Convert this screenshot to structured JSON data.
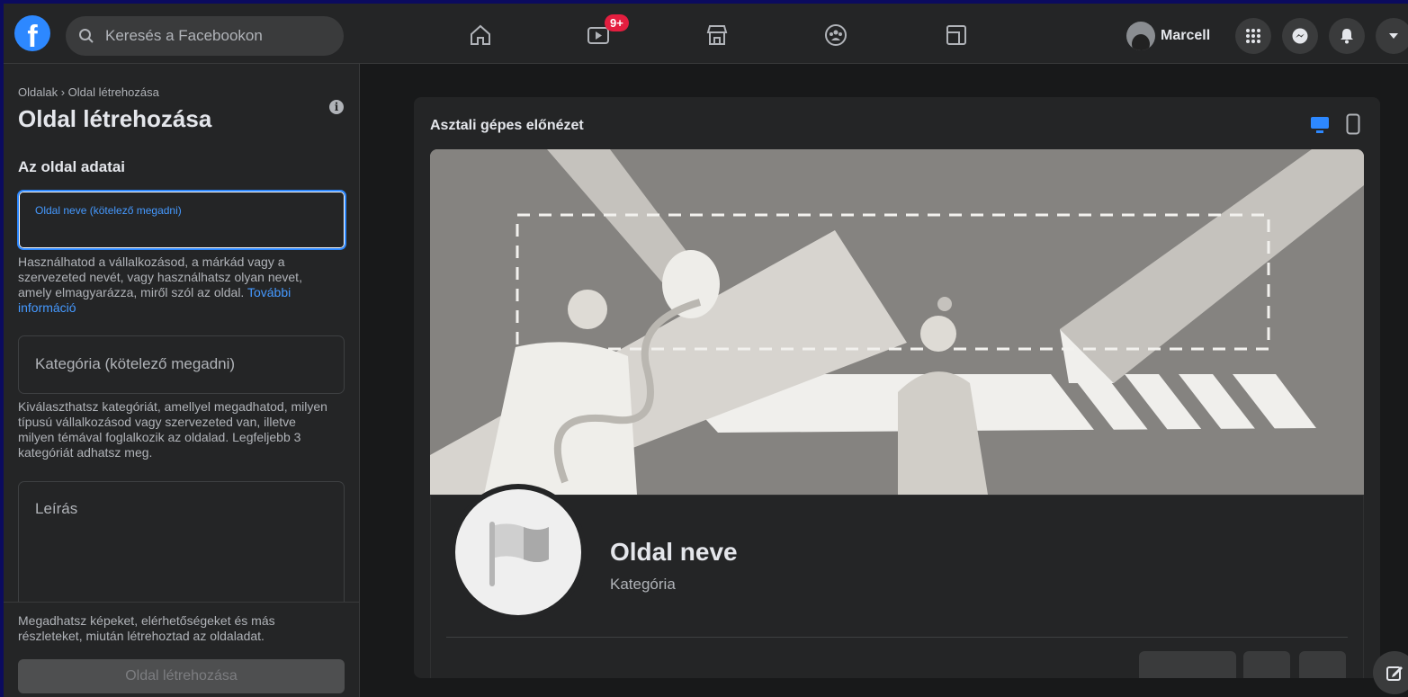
{
  "topbar": {
    "logo_letter": "f",
    "search_placeholder": "Keresés a Facebookon",
    "watch_badge": "9+",
    "profile_name": "Marcell"
  },
  "left_panel": {
    "breadcrumb": "Oldalak › Oldal létrehozása",
    "title": "Oldal létrehozása",
    "section_title": "Az oldal adatai",
    "name_field_label": "Oldal neve (kötelező megadni)",
    "name_help": "Használhatod a vállalkozásod, a márkád vagy a szervezeted nevét, vagy használhatsz olyan nevet, amely elmagyarázza, miről szól az oldal.",
    "name_help_link": "További információ",
    "category_placeholder": "Kategória (kötelező megadni)",
    "category_help": "Kiválaszthatsz kategóriát, amellyel megadhatod, milyen típusú vállalkozásod vagy szervezeted van, illetve milyen témával foglalkozik az oldalad. Legfeljebb 3 kategóriát adhatsz meg.",
    "description_placeholder": "Leírás",
    "footer_help": "Megadhatsz képeket, elérhetőségeket és más részleteket, miután létrehoztad az oldaladat.",
    "create_button": "Oldal létrehozása"
  },
  "preview": {
    "title": "Asztali gépes előnézet",
    "page_name": "Oldal neve",
    "page_category": "Kategória",
    "colors": {
      "accent": "#2d88ff",
      "cover_bg": "#858380"
    }
  }
}
